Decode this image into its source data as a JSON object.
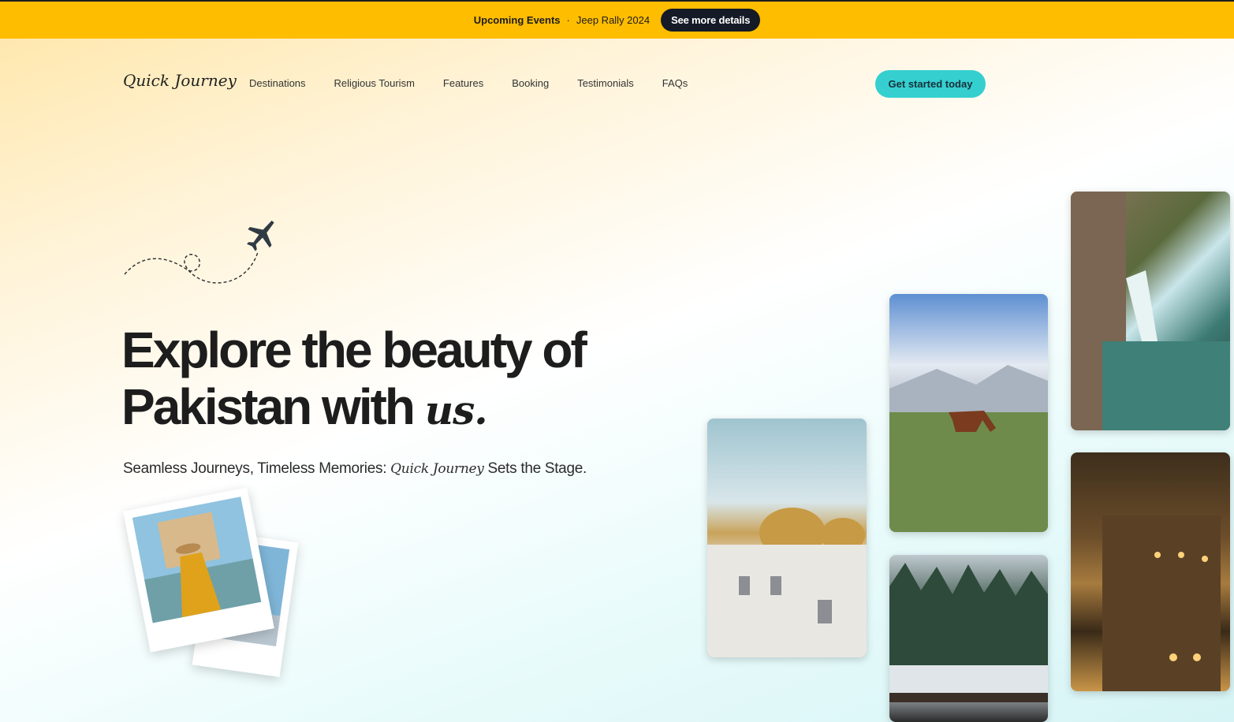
{
  "announcement": {
    "label": "Upcoming Events",
    "separator": "·",
    "event": "Jeep Rally 2024",
    "button": "See more details"
  },
  "header": {
    "logo": "Quick Journey",
    "nav": [
      "Destinations",
      "Religious Tourism",
      "Features",
      "Booking",
      "Testimonials",
      "FAQs"
    ],
    "cta": "Get started today"
  },
  "hero": {
    "headline_part1": "Explore the beauty of",
    "headline_part2": "Pakistan with",
    "headline_accent": "us.",
    "sub_before": "Seamless Journeys, Timeless Memories:",
    "sub_brand": "Quick Journey",
    "sub_after": "Sets the Stage."
  },
  "icons": {
    "plane": "airplane-icon"
  },
  "colors": {
    "topbar": "#ffbd00",
    "cta": "#35cfd0",
    "button_dark": "#141a26"
  }
}
